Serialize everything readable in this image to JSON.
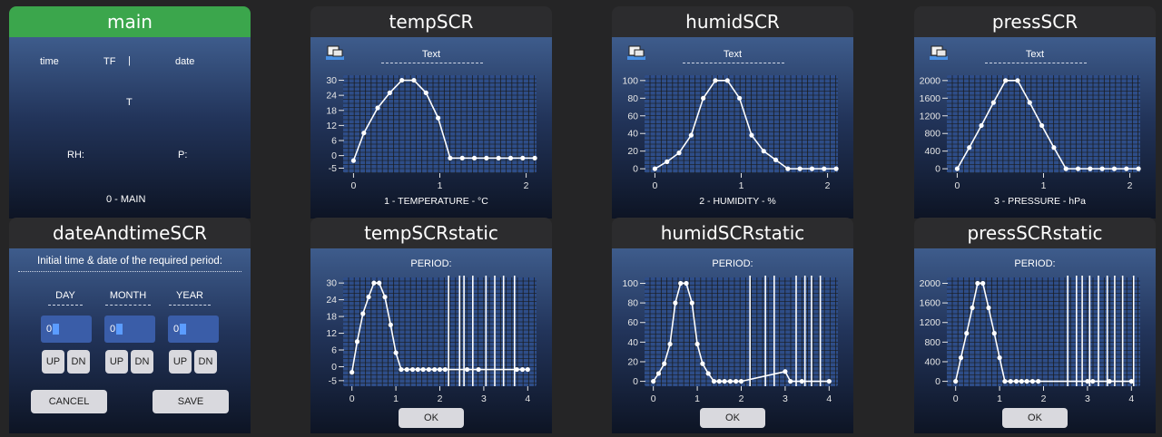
{
  "tabs": {
    "main": "main",
    "tempSCR": "tempSCR",
    "humidSCR": "humidSCR",
    "pressSCR": "pressSCR",
    "dateAndtimeSCR": "dateAndtimeSCR",
    "tempSCRstatic": "tempSCRstatic",
    "humidSCRstatic": "humidSCRstatic",
    "pressSCRstatic": "pressSCRstatic"
  },
  "main": {
    "time": "time",
    "tf": "TF",
    "sep": "|",
    "date": "date",
    "t": "T",
    "rh": "RH:",
    "p": "P:",
    "footer": "0 - MAIN"
  },
  "header_text": "Text",
  "period_label": "PERIOD:",
  "ok_label": "OK",
  "date_screen": {
    "title": "Initial time & date of the required period:",
    "day": "DAY",
    "month": "MONTH",
    "year": "YEAR",
    "day_value": "0",
    "month_value": "0",
    "year_value": "0",
    "up": "UP",
    "dn": "DN",
    "cancel": "CANCEL",
    "save": "SAVE"
  },
  "colors": {
    "active_tab": "#3ba64c",
    "tab": "#2c2c2e",
    "screen_top": "#3e5c8c",
    "screen_bottom": "#0d1424",
    "plot_bg": "#2e4d88",
    "button": "#d9d9de",
    "field": "#3a5da8"
  },
  "chart_data": [
    {
      "id": "tempSCR",
      "type": "line",
      "xlabel": "1 - TEMPERATURE - °C",
      "xlim": [
        -0.12,
        2.12
      ],
      "ylim": [
        -7,
        32
      ],
      "xticks": [
        0,
        1,
        2
      ],
      "yticks": [
        30,
        24,
        18,
        12,
        6,
        0,
        -5
      ],
      "x": [
        0,
        0.12,
        0.28,
        0.42,
        0.56,
        0.7,
        0.84,
        0.98,
        1.12,
        1.26,
        1.4,
        1.54,
        1.68,
        1.82,
        1.96,
        2.1
      ],
      "y": [
        -2,
        9,
        19,
        25,
        30,
        30,
        25,
        15,
        -1,
        -1,
        -1,
        -1,
        -1,
        -1,
        -1,
        -1
      ]
    },
    {
      "id": "humidSCR",
      "type": "line",
      "xlabel": "2 - HUMIDITY - %",
      "xlim": [
        -0.12,
        2.12
      ],
      "ylim": [
        -5,
        106
      ],
      "xticks": [
        0,
        1,
        2
      ],
      "yticks": [
        100,
        80,
        60,
        40,
        20,
        0
      ],
      "x": [
        0,
        0.14,
        0.28,
        0.42,
        0.56,
        0.7,
        0.84,
        0.98,
        1.12,
        1.26,
        1.4,
        1.54,
        1.68,
        1.82,
        1.96,
        2.1
      ],
      "y": [
        0,
        8,
        18,
        38,
        80,
        100,
        100,
        80,
        38,
        20,
        10,
        0,
        0,
        0,
        0,
        0
      ]
    },
    {
      "id": "pressSCR",
      "type": "line",
      "xlabel": "3 - PRESSURE - hPa",
      "xlim": [
        -0.12,
        2.12
      ],
      "ylim": [
        -100,
        2120
      ],
      "xticks": [
        0,
        1,
        2
      ],
      "yticks": [
        2000,
        1600,
        1200,
        800,
        400,
        0
      ],
      "x": [
        0,
        0.14,
        0.28,
        0.42,
        0.56,
        0.7,
        0.84,
        0.98,
        1.12,
        1.26,
        1.4,
        1.54,
        1.68,
        1.82,
        1.96,
        2.1
      ],
      "y": [
        0,
        480,
        980,
        1500,
        2000,
        2000,
        1500,
        980,
        480,
        0,
        0,
        0,
        0,
        0,
        0,
        0
      ]
    },
    {
      "id": "tempSCRstatic",
      "type": "line",
      "xlim": [
        -0.2,
        4.2
      ],
      "ylim": [
        -7,
        32
      ],
      "xticks": [
        0,
        1,
        2,
        3,
        4
      ],
      "yticks": [
        30,
        24,
        18,
        12,
        6,
        0,
        -5
      ],
      "x": [
        0,
        0.12,
        0.25,
        0.38,
        0.5,
        0.62,
        0.75,
        0.88,
        1.0,
        1.12,
        1.25,
        1.38,
        1.5,
        1.62,
        1.75,
        1.88,
        2.0,
        2.12,
        2.62,
        2.88,
        3.75,
        3.88,
        4.0
      ],
      "y": [
        -2,
        9,
        19,
        25,
        30,
        30,
        25,
        15,
        5,
        -1,
        -1,
        -1,
        -1,
        -1,
        -1,
        -1,
        -1,
        -1,
        -1,
        -1,
        -1,
        -1,
        -1
      ],
      "vlines": [
        2.2,
        2.45,
        2.55,
        2.75,
        3.05,
        3.25,
        3.45,
        3.7
      ]
    },
    {
      "id": "humidSCRstatic",
      "type": "line",
      "xlim": [
        -0.2,
        4.2
      ],
      "ylim": [
        -5,
        106
      ],
      "xticks": [
        0,
        1,
        2,
        3,
        4
      ],
      "yticks": [
        100,
        80,
        60,
        40,
        20,
        0
      ],
      "x": [
        0,
        0.12,
        0.25,
        0.38,
        0.5,
        0.62,
        0.75,
        0.88,
        1.0,
        1.12,
        1.25,
        1.38,
        1.5,
        1.62,
        1.75,
        1.88,
        2.0,
        3.0,
        3.12,
        3.38,
        4.0
      ],
      "y": [
        0,
        8,
        18,
        38,
        80,
        100,
        100,
        80,
        38,
        18,
        8,
        0,
        0,
        0,
        0,
        0,
        0,
        10,
        0,
        0,
        0
      ],
      "vlines": [
        2.2,
        2.55,
        2.75,
        3.25,
        3.45,
        3.6,
        3.8
      ]
    },
    {
      "id": "pressSCRstatic",
      "type": "line",
      "xlim": [
        -0.2,
        4.2
      ],
      "ylim": [
        -100,
        2120
      ],
      "xticks": [
        0,
        1,
        2,
        3,
        4
      ],
      "yticks": [
        2000,
        1600,
        1200,
        800,
        400,
        0
      ],
      "x": [
        0,
        0.12,
        0.25,
        0.38,
        0.5,
        0.62,
        0.75,
        0.88,
        1.0,
        1.12,
        1.25,
        1.38,
        1.5,
        1.62,
        1.75,
        1.88,
        3.0,
        3.12,
        3.5,
        4.0
      ],
      "y": [
        0,
        480,
        980,
        1500,
        2000,
        2000,
        1500,
        980,
        480,
        0,
        0,
        0,
        0,
        0,
        0,
        0,
        0,
        0,
        0,
        0
      ],
      "vlines": [
        2.55,
        2.75,
        2.88,
        3.05,
        3.25,
        3.45,
        3.62,
        3.8,
        4.05
      ]
    }
  ]
}
